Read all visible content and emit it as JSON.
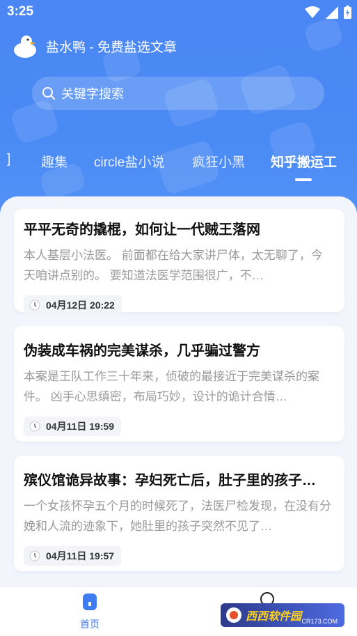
{
  "status_bar": {
    "time": "3:25"
  },
  "app": {
    "title": "盐水鸭 - 免费盐选文章",
    "logo_icon": "duck-logo-icon"
  },
  "search": {
    "placeholder": "关键字搜索"
  },
  "tabs": [
    {
      "label": "]"
    },
    {
      "label": "趣集"
    },
    {
      "label": "circle盐小说"
    },
    {
      "label": "疯狂小黑"
    },
    {
      "label": "知乎搬运工",
      "active": true
    }
  ],
  "articles": [
    {
      "title": "平平无奇的撬棍，如何让一代贼王落网",
      "summary": "本人基层小法医。 前面都在给大家讲尸体，太无聊了，今天咱讲点别的。 要知道法医学范围很广，不…",
      "date": "04月12日 20:22"
    },
    {
      "title": "伪装成车祸的完美谋杀，几乎骗过警方",
      "summary": "本案是王队工作三十年来，侦破的最接近于完美谋杀的案件。 凶手心思缜密，布局巧妙，设计的诡计合情…",
      "date": "04月11日 19:59"
    },
    {
      "title": "殡仪馆诡异故事：孕妇死亡后，肚子里的孩子…",
      "summary": "一个女孩怀孕五个月的时候死了，法医尸检发现，在没有分娩和人流的迹象下，她肚里的孩子突然不见了…",
      "date": "04月11日 19:57"
    }
  ],
  "bottom_nav": {
    "home_label": "首页"
  },
  "watermark": {
    "text": "西西软件园",
    "sub": "CR173.COM"
  },
  "colors": {
    "primary": "#4a86f4",
    "accent": "#3f7cf0"
  }
}
